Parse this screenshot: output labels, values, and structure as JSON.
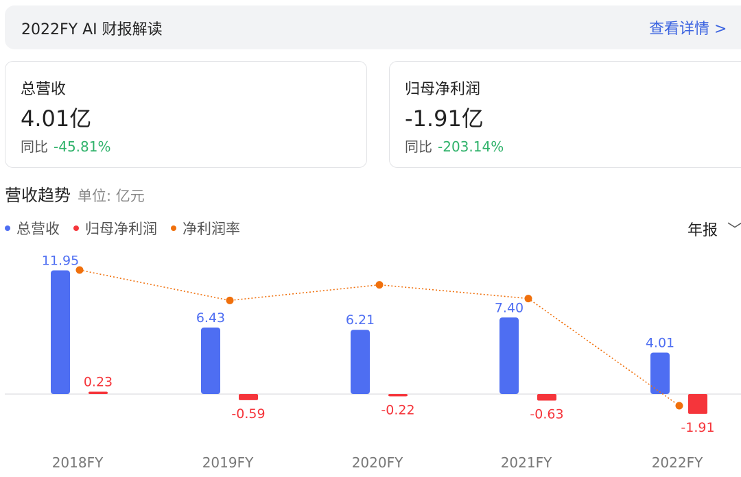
{
  "banner": {
    "title": "2022FY AI 财报解读",
    "link_label": "查看详情 >"
  },
  "cards": [
    {
      "label": "总营收",
      "value": "4.01亿",
      "yoy_label": "同比",
      "yoy_value": "-45.81%"
    },
    {
      "label": "归母净利润",
      "value": "-1.91亿",
      "yoy_label": "同比",
      "yoy_value": "-203.14%"
    }
  ],
  "section": {
    "title": "营收趋势",
    "unit": "单位: 亿元"
  },
  "period_selector": {
    "label": "年报",
    "icon": "chevron-down-icon"
  },
  "colors": {
    "revenue": "#4e6ef2",
    "net_profit": "#f5353b",
    "margin": "#f0700c",
    "positive": "#2fb26a",
    "link": "#3b63e0"
  },
  "chart_data": {
    "type": "bar",
    "categories": [
      "2018FY",
      "2019FY",
      "2020FY",
      "2021FY",
      "2022FY"
    ],
    "series": [
      {
        "name": "总营收",
        "type": "bar",
        "values": [
          11.95,
          6.43,
          6.21,
          7.4,
          4.01
        ],
        "labels": [
          "11.95",
          "6.43",
          "6.21",
          "7.40",
          "4.01"
        ]
      },
      {
        "name": "归母净利润",
        "type": "bar",
        "values": [
          0.23,
          -0.59,
          -0.22,
          -0.63,
          -1.91
        ],
        "labels": [
          "0.23",
          "-0.59",
          "-0.22",
          "-0.63",
          "-1.91"
        ]
      },
      {
        "name": "净利润率",
        "type": "line",
        "values": [
          1.9,
          -9.2,
          -3.5,
          -8.5,
          -47.6
        ]
      }
    ],
    "unit": "亿元"
  }
}
